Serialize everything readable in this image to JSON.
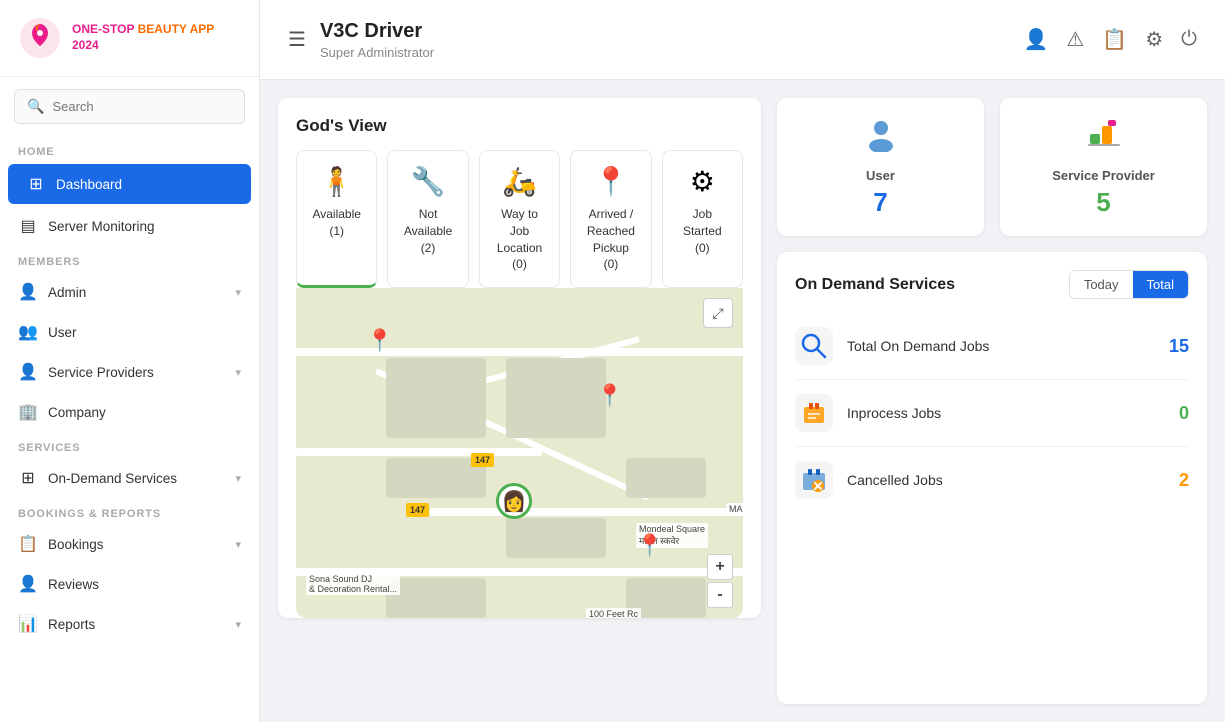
{
  "sidebar": {
    "logo": {
      "text1": "ONE-STOP",
      "text2": "BEAUTY APP",
      "year": "2024"
    },
    "search": {
      "placeholder": "Search"
    },
    "sections": [
      {
        "label": "HOME",
        "items": [
          {
            "id": "dashboard",
            "label": "Dashboard",
            "icon": "⊞",
            "active": true
          },
          {
            "id": "server-monitoring",
            "label": "Server Monitoring",
            "icon": "▤",
            "active": false
          }
        ]
      },
      {
        "label": "MEMBERS",
        "items": [
          {
            "id": "admin",
            "label": "Admin",
            "icon": "👤",
            "active": false,
            "hasChevron": true
          },
          {
            "id": "user",
            "label": "User",
            "icon": "👥",
            "active": false,
            "hasChevron": false
          },
          {
            "id": "service-providers",
            "label": "Service Providers",
            "icon": "👤",
            "active": false,
            "hasChevron": true
          },
          {
            "id": "company",
            "label": "Company",
            "icon": "🏢",
            "active": false,
            "hasChevron": false
          }
        ]
      },
      {
        "label": "SERVICES",
        "items": [
          {
            "id": "on-demand-services",
            "label": "On-Demand Services",
            "icon": "⊞",
            "active": false,
            "hasChevron": true
          }
        ]
      },
      {
        "label": "BOOKINGS & REPORTS",
        "items": [
          {
            "id": "bookings",
            "label": "Bookings",
            "icon": "📋",
            "active": false,
            "hasChevron": true
          },
          {
            "id": "reviews",
            "label": "Reviews",
            "icon": "👤",
            "active": false,
            "hasChevron": false
          },
          {
            "id": "reports",
            "label": "Reports",
            "icon": "📊",
            "active": false,
            "hasChevron": true
          }
        ]
      }
    ]
  },
  "header": {
    "title": "V3C Driver",
    "subtitle": "Super Administrator",
    "icons": [
      "👤",
      "⚠",
      "📋",
      "⚙",
      "⏻"
    ]
  },
  "gods_view": {
    "title": "God's View",
    "status_cards": [
      {
        "id": "available",
        "icon": "🧍",
        "label": "Available",
        "count": "(1)",
        "active": true
      },
      {
        "id": "not-available",
        "icon": "🔧",
        "label": "Not Available",
        "count": "(2)",
        "active": false
      },
      {
        "id": "way-to-job",
        "icon": "🛵",
        "label": "Way to Job Location",
        "count": "(0)",
        "active": false
      },
      {
        "id": "arrived",
        "icon": "📍",
        "label": "Arrived / Reached Pickup",
        "count": "(0)",
        "active": false
      },
      {
        "id": "job-started",
        "icon": "⚙",
        "label": "Job Started",
        "count": "(0)",
        "active": false
      }
    ]
  },
  "map": {
    "labels": [
      "Sona Sound DJ & Decoration Rental...",
      "Mondeal Square मांडल स्कवेर",
      "MADHAVR..."
    ],
    "signs": [
      "147",
      "147"
    ],
    "expand_icon": "⤢",
    "zoom_plus": "+",
    "zoom_minus": "-"
  },
  "stats": {
    "user": {
      "label": "User",
      "value": "7",
      "color": "blue"
    },
    "service_provider": {
      "label": "Service Provider",
      "value": "5",
      "color": "green"
    }
  },
  "on_demand": {
    "title": "On Demand Services",
    "toggle_today": "Today",
    "toggle_total": "Total",
    "active_toggle": "total",
    "items": [
      {
        "id": "total-jobs",
        "icon": "🔍",
        "label": "Total On Demand Jobs",
        "value": "15",
        "color": "blue"
      },
      {
        "id": "inprocess-jobs",
        "icon": "💼",
        "label": "Inprocess Jobs",
        "value": "0",
        "color": "green"
      },
      {
        "id": "cancelled-jobs",
        "icon": "🗂",
        "label": "Cancelled Jobs",
        "value": "2",
        "color": "orange"
      }
    ]
  }
}
